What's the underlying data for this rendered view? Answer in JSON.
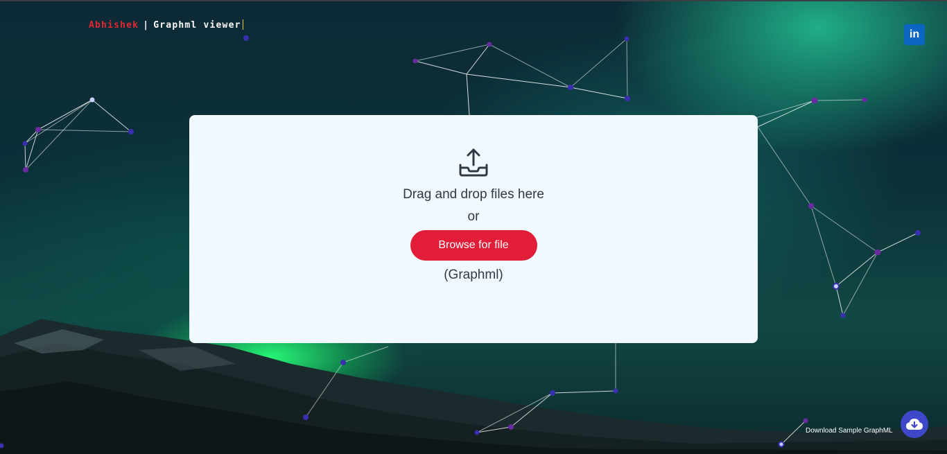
{
  "header": {
    "brand_name": "Abhishek",
    "separator": "|",
    "app_title": "Graphml viewer"
  },
  "social": {
    "linkedin_label": "in"
  },
  "upload": {
    "drag_text": "Drag and drop files here",
    "or_text": "or",
    "browse_label": "Browse for file",
    "file_type": "(Graphml)"
  },
  "download": {
    "label": "Download Sample GraphML"
  },
  "colors": {
    "accent": "#e11d38",
    "node": "#3a2fb0",
    "linkedin": "#0a66c2",
    "download_button": "#3f48c8"
  }
}
